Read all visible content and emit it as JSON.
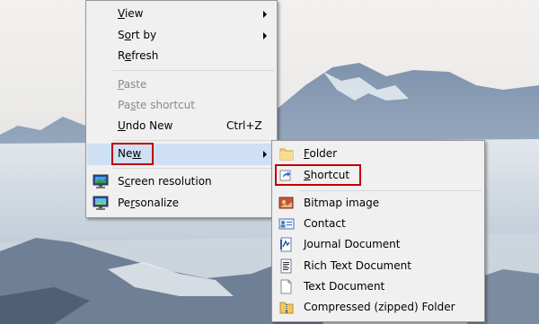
{
  "context_menu": {
    "items": [
      {
        "label": "View",
        "mnemonic": "V",
        "has_submenu": true
      },
      {
        "label": "Sort by",
        "mnemonic": "o",
        "has_submenu": true
      },
      {
        "label": "Refresh",
        "mnemonic": "e",
        "has_submenu": false
      },
      {
        "label": "Paste",
        "mnemonic": "P",
        "disabled": true
      },
      {
        "label": "Paste shortcut",
        "mnemonic": "s",
        "disabled": true
      },
      {
        "label": "Undo New",
        "mnemonic": "U",
        "shortcut": "Ctrl+Z"
      },
      {
        "label": "New",
        "mnemonic": "w",
        "has_submenu": true,
        "highlighted": true
      },
      {
        "label": "Screen resolution",
        "mnemonic": "c",
        "icon": "screen-resolution-icon"
      },
      {
        "label": "Personalize",
        "mnemonic": "r",
        "icon": "personalize-icon"
      }
    ]
  },
  "new_submenu": {
    "items": [
      {
        "label": "Folder",
        "mnemonic": "F",
        "icon": "folder-icon"
      },
      {
        "label": "Shortcut",
        "mnemonic": "S",
        "icon": "shortcut-icon",
        "outlined": true
      },
      {
        "label": "Bitmap image",
        "icon": "bitmap-image-icon"
      },
      {
        "label": "Contact",
        "icon": "contact-icon"
      },
      {
        "label": "Journal Document",
        "icon": "journal-document-icon"
      },
      {
        "label": "Rich Text Document",
        "icon": "rich-text-document-icon"
      },
      {
        "label": "Text Document",
        "icon": "text-document-icon"
      },
      {
        "label": "Compressed (zipped) Folder",
        "icon": "zipped-folder-icon"
      }
    ]
  },
  "colors": {
    "menu_background": "#f0f0f0",
    "highlight": "#cfe0f5",
    "annotation_box": "#c00000",
    "disabled_text": "#8a8a8a"
  }
}
